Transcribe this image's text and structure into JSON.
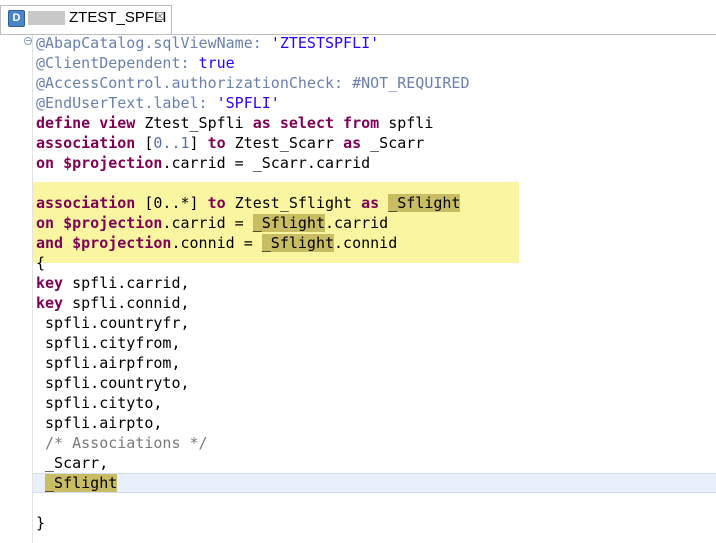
{
  "tab": {
    "icon_letter": "D",
    "title": "ZTEST_SPFLI",
    "close_glyph": "☒"
  },
  "editor": {
    "fold_glyph": "−",
    "lines": [
      [
        {
          "t": "@AbapCatalog.sqlViewName: ",
          "c": "ann"
        },
        {
          "t": "'ZTESTSPFLI'",
          "c": "str"
        }
      ],
      [
        {
          "t": "@ClientDependent: ",
          "c": "ann"
        },
        {
          "t": "true",
          "c": "str"
        }
      ],
      [
        {
          "t": "@AccessControl.authorizationCheck: #NOT_REQUIRED",
          "c": "ann"
        }
      ],
      [
        {
          "t": "@EndUserText.label: ",
          "c": "ann"
        },
        {
          "t": "'SPFLI'",
          "c": "str"
        }
      ],
      [
        {
          "t": "define view",
          "c": "kw"
        },
        {
          "t": " Ztest_Spfli "
        },
        {
          "t": "as select from",
          "c": "kw"
        },
        {
          "t": " spfli"
        }
      ],
      [
        {
          "t": "association",
          "c": "kw"
        },
        {
          "t": " ["
        },
        {
          "t": "0..1",
          "c": "num"
        },
        {
          "t": "] "
        },
        {
          "t": "to",
          "c": "kw"
        },
        {
          "t": " Ztest_Scarr "
        },
        {
          "t": "as",
          "c": "kw"
        },
        {
          "t": " _Scarr"
        }
      ],
      [
        {
          "t": "on",
          "c": "kw"
        },
        {
          "t": " "
        },
        {
          "t": "$projection",
          "c": "kw"
        },
        {
          "t": ".carrid = _Scarr.carrid"
        }
      ],
      [
        {
          "t": ""
        }
      ],
      [
        {
          "t": "association",
          "c": "kw"
        },
        {
          "t": " [0..*] "
        },
        {
          "t": "to",
          "c": "kw"
        },
        {
          "t": " Ztest_Sflight "
        },
        {
          "t": "as",
          "c": "kw"
        },
        {
          "t": " "
        },
        {
          "t": "_Sflight",
          "c": "mark"
        }
      ],
      [
        {
          "t": "on",
          "c": "kw"
        },
        {
          "t": " "
        },
        {
          "t": "$projection",
          "c": "kw"
        },
        {
          "t": ".carrid = "
        },
        {
          "t": "_Sflight",
          "c": "mark"
        },
        {
          "t": ".carrid"
        }
      ],
      [
        {
          "t": "and",
          "c": "kw"
        },
        {
          "t": " "
        },
        {
          "t": "$projection",
          "c": "kw"
        },
        {
          "t": ".connid = "
        },
        {
          "t": "_Sflight",
          "c": "mark"
        },
        {
          "t": ".connid"
        }
      ],
      [
        {
          "t": "{"
        }
      ],
      [
        {
          "t": "key",
          "c": "kw"
        },
        {
          "t": " spfli.carrid,"
        }
      ],
      [
        {
          "t": "key",
          "c": "kw"
        },
        {
          "t": " spfli.connid,"
        }
      ],
      [
        {
          "t": " spfli.countryfr,"
        }
      ],
      [
        {
          "t": " spfli.cityfrom,"
        }
      ],
      [
        {
          "t": " spfli.airpfrom,"
        }
      ],
      [
        {
          "t": " spfli.countryto,"
        }
      ],
      [
        {
          "t": " spfli.cityto,"
        }
      ],
      [
        {
          "t": " spfli.airpto,"
        }
      ],
      [
        {
          "t": " /* Associations */",
          "c": "cmt"
        }
      ],
      [
        {
          "t": " _Scarr,"
        }
      ],
      [
        {
          "t": " "
        },
        {
          "t": "_Sflight",
          "c": "mark"
        }
      ],
      [
        {
          "t": ""
        }
      ],
      [
        {
          "t": "}"
        }
      ]
    ]
  }
}
